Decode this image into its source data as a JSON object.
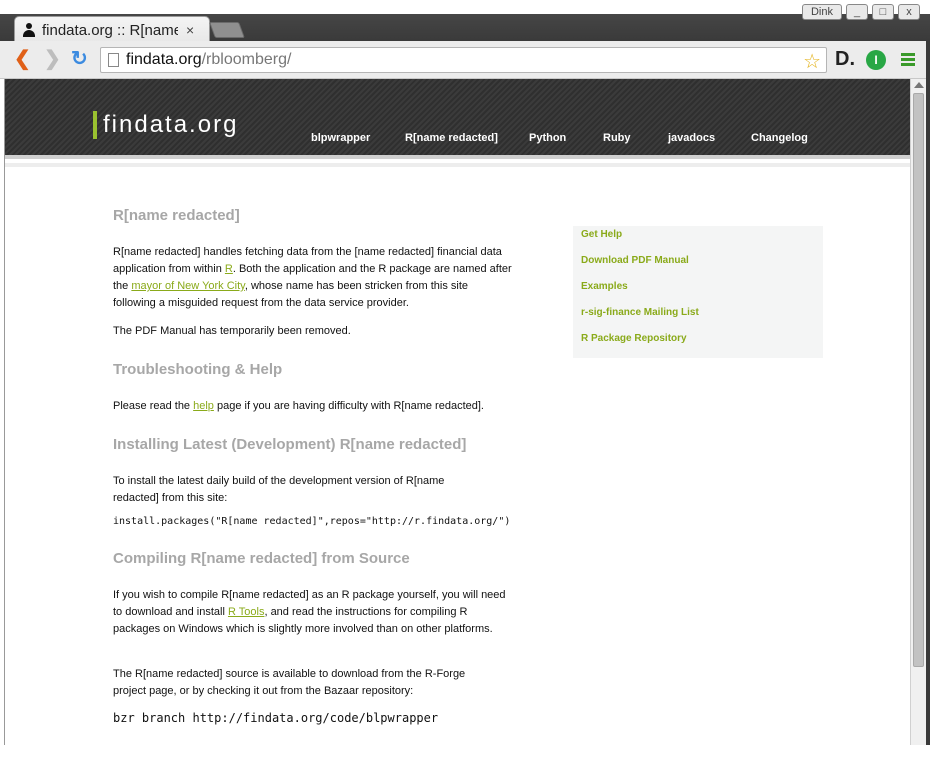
{
  "browser": {
    "tab_title": "findata.org :: R[name redacted]",
    "tab_close": "×",
    "window_buttons": [
      "Dink",
      "_",
      "□",
      "x"
    ],
    "url_host": "findata.org",
    "url_path": "/rbloomberg/",
    "ext_d_label": "D.",
    "ext_i_label": "I"
  },
  "site": {
    "logo": "findata.org",
    "nav": [
      "blpwrapper",
      "R[name redacted]",
      "Python",
      "Ruby",
      "javadocs",
      "Changelog"
    ]
  },
  "main": {
    "title": "R[name redacted]",
    "intro": {
      "part1": "R[name redacted] handles fetching data from the [name redacted] financial data application from within ",
      "link_r": "R",
      "part2": ". Both the application and the R package are named after the ",
      "link_mayor": "mayor of New York City",
      "part3": ", whose name has been stricken from this site following a misguided request from the data service provider."
    },
    "pdf_note": "The PDF Manual has temporarily been removed.",
    "troubleshooting_title": "Troubleshooting & Help",
    "troubleshooting": {
      "part1": "Please read the ",
      "link_help": "help",
      "part2": " page if you are having difficulty with R[name redacted]."
    },
    "installing_title": "Installing Latest (Development) R[name redacted]",
    "installing_text": "To install the latest daily build of the development version of R[name redacted] from this site:",
    "installing_code": "install.packages(\"R[name redacted]\",repos=\"http://r.findata.org/\")",
    "compiling_title": "Compiling R[name redacted] from Source",
    "compiling": {
      "part1": "If you wish to compile R[name redacted] as an R package yourself, you will need to download and install ",
      "link_rtools": "R Tools",
      "part2": ", and read the instructions for compiling R packages on Windows which is slightly more involved than on other platforms."
    },
    "source_text": "The R[name redacted] source is available to download from the R-Forge project page, or by checking it out from the Bazaar repository:",
    "bzr_code": "bzr branch http://findata.org/code/blpwrapper"
  },
  "sidebar": {
    "items": [
      "Get Help",
      "Download PDF Manual",
      "Examples",
      "r-sig-finance Mailing List",
      "R Package Repository"
    ]
  },
  "colors": {
    "accent": "#8aaa1a",
    "heading": "#a7a7a7",
    "header_bg": "#333333"
  }
}
